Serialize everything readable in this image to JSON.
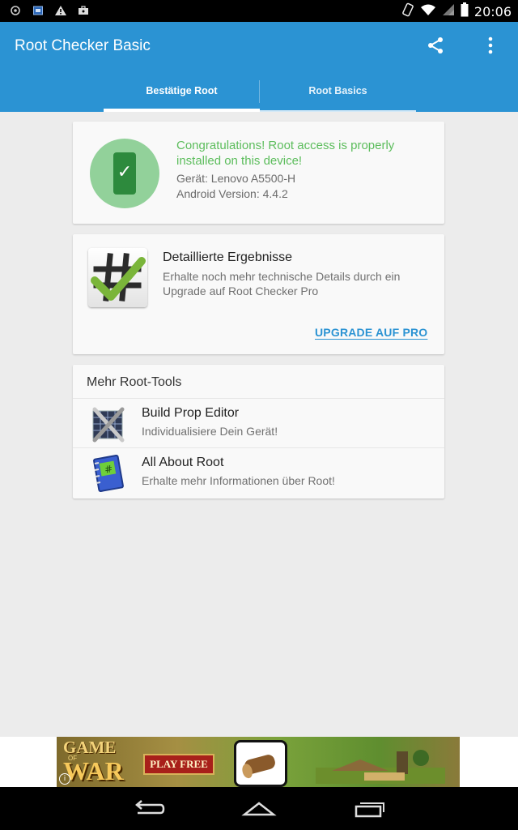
{
  "status_bar": {
    "time": "20:06",
    "left_icons": [
      "settings-icon",
      "calendar-icon",
      "warning-icon",
      "briefcase-icon"
    ],
    "right_icons": [
      "rotate-icon",
      "wifi-icon",
      "signal-icon",
      "battery-icon"
    ]
  },
  "app_bar": {
    "title": "Root Checker Basic",
    "actions": [
      "share-icon",
      "overflow-menu-icon"
    ]
  },
  "tabs": [
    {
      "label": "Bestätige Root",
      "active": true
    },
    {
      "label": "Root Basics",
      "active": false
    }
  ],
  "result_card": {
    "message": "Congratulations! Root access is properly installed on this device!",
    "device": "Gerät: Lenovo A5500-H",
    "android_version": "Android Version: 4.4.2",
    "icon": "check-phone-icon"
  },
  "upgrade_card": {
    "title": "Detaillierte Ergebnisse",
    "description": "Erhalte noch mehr technische Details durch ein Upgrade auf Root Checker Pro",
    "button_label": "UPGRADE AUF PRO",
    "icon": "root-checker-logo-icon"
  },
  "tools_card": {
    "heading": "Mehr Root-Tools",
    "items": [
      {
        "name": "Build Prop Editor",
        "description": "Individualisiere Dein Gerät!",
        "icon": "build-prop-editor-icon"
      },
      {
        "name": "All About Root",
        "description": "Erhalte mehr Informationen über Root!",
        "icon": "all-about-root-icon"
      }
    ]
  },
  "ad_banner": {
    "line1": "GAME",
    "line2": "WAR",
    "of": "OF",
    "button": "PLAY FREE"
  },
  "nav_bar": {
    "buttons": [
      "back-icon",
      "home-icon",
      "recent-apps-icon"
    ]
  },
  "colors": {
    "app_bar": "#2b93d3",
    "success": "#5cbd5c",
    "link": "#2b93d3"
  }
}
